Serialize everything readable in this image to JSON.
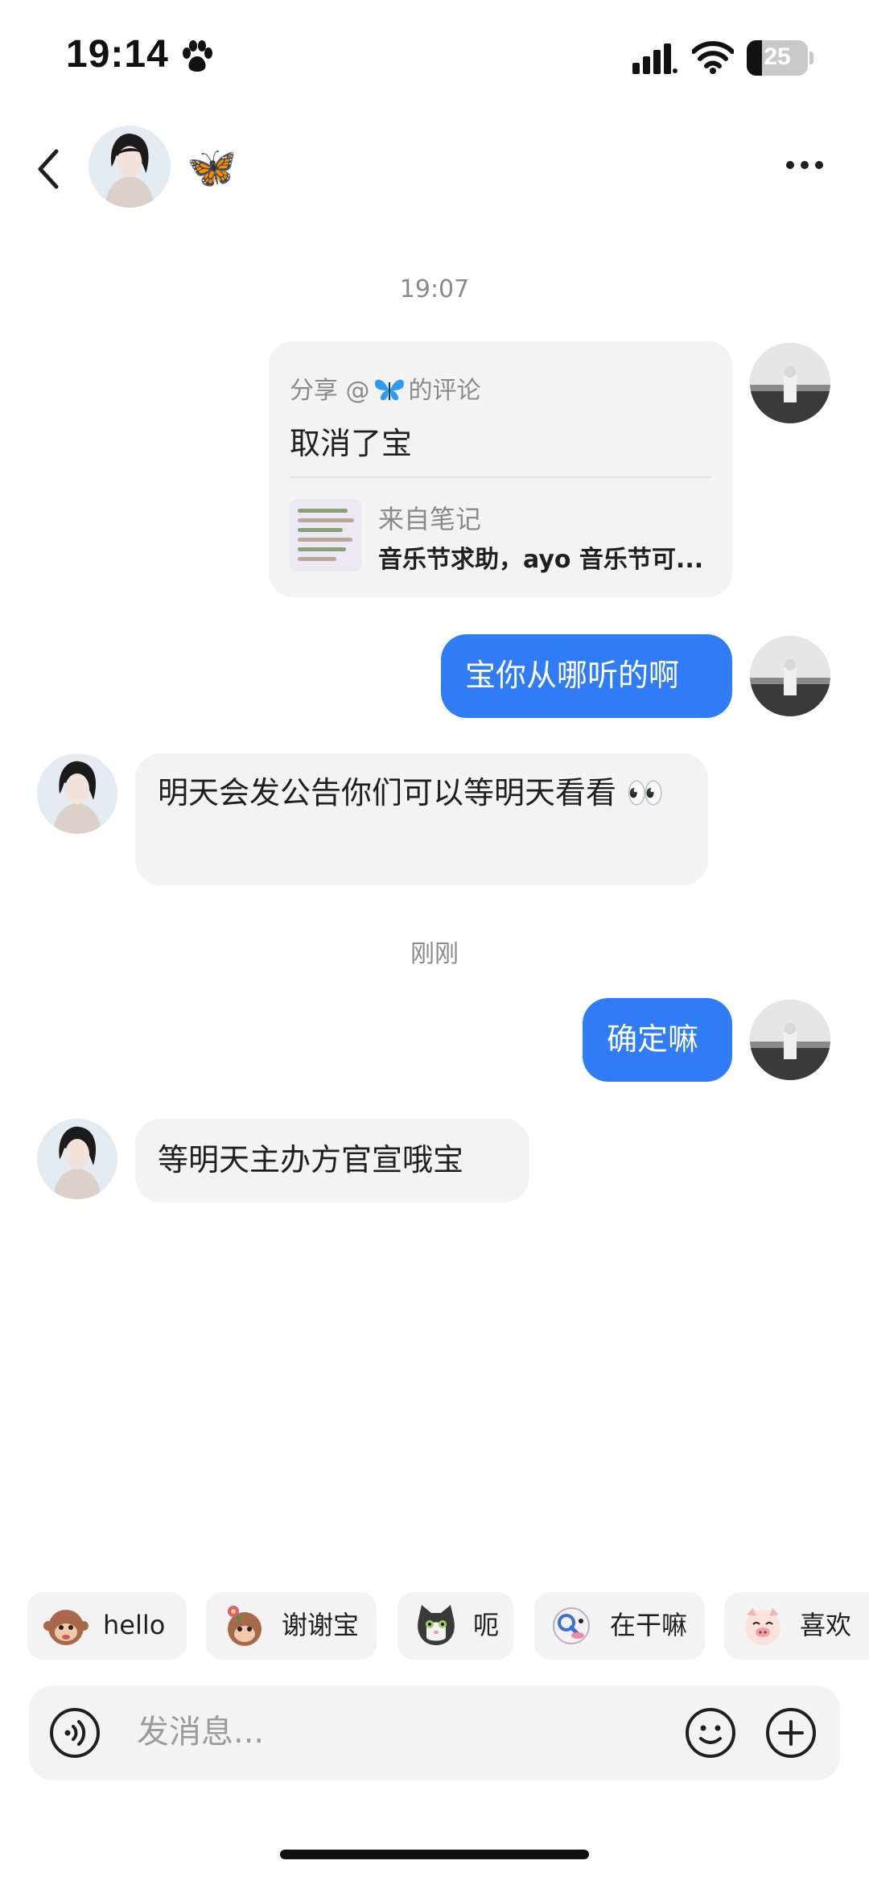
{
  "status_bar": {
    "time": "19:14",
    "battery": "25",
    "battery_level": 0.25
  },
  "header": {
    "contact_name": "🦋"
  },
  "conversation": {
    "timestamp_1": "19:07",
    "share_card": {
      "header_prefix": "分享 @",
      "header_suffix": "的评论",
      "comment": "取消了宝",
      "source_label": "来自笔记",
      "note_title": "音乐节求助，ayo 音乐节可..."
    },
    "msg_sent_1": "宝你从哪听的啊",
    "msg_received_1": "明天会发公告你们可以等明天看看 👀",
    "timestamp_2": "刚刚",
    "msg_sent_2": "确定嘛",
    "msg_received_2": "等明天主办方官宣哦宝"
  },
  "quick_replies": [
    {
      "label": "hello",
      "icon": "monkey-wave-sticker"
    },
    {
      "label": "谢谢宝",
      "icon": "monkey-flower-sticker"
    },
    {
      "label": "呃",
      "icon": "cat-sticker"
    },
    {
      "label": "在干嘛",
      "icon": "magnifier-sticker"
    },
    {
      "label": "喜欢",
      "icon": "pig-sticker"
    }
  ],
  "composer": {
    "placeholder": "发消息..."
  },
  "colors": {
    "sent_bubble": "#2f7cf6",
    "received_bubble": "#f3f3f3",
    "accent_butterfly": "#2e9bf0"
  }
}
